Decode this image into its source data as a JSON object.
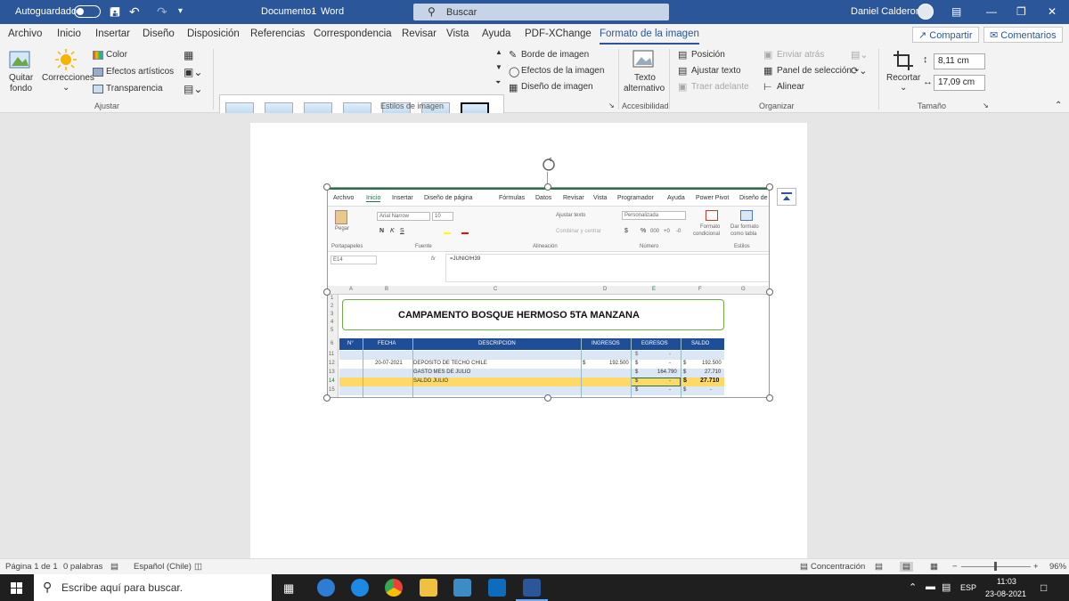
{
  "window": {
    "autosave_label": "Autoguardado",
    "doc_title": "Documento1",
    "app_name": "Word",
    "search_placeholder": "Buscar",
    "user_name": "Daniel Calderon"
  },
  "tabs": {
    "items": [
      "Archivo",
      "Inicio",
      "Insertar",
      "Diseño",
      "Disposición",
      "Referencias",
      "Correspondencia",
      "Revisar",
      "Vista",
      "Ayuda",
      "PDF-XChange",
      "Formato de la imagen"
    ],
    "active": "Formato de la imagen",
    "share": "Compartir",
    "comments": "Comentarios"
  },
  "ribbon": {
    "ajustar": {
      "quitar_fondo_1": "Quitar",
      "quitar_fondo_2": "fondo",
      "correcciones": "Correcciones",
      "color": "Color",
      "efectos_artisticos": "Efectos artísticos",
      "transparencia": "Transparencia",
      "label": "Ajustar"
    },
    "estilos": {
      "borde": "Borde de imagen",
      "efectos": "Efectos de la imagen",
      "diseno": "Diseño de imagen",
      "label": "Estilos de imagen"
    },
    "accesibilidad": {
      "texto_1": "Texto",
      "texto_2": "alternativo",
      "label": "Accesibilidad"
    },
    "organizar": {
      "posicion": "Posición",
      "ajustar_texto": "Ajustar texto",
      "traer_adelante": "Traer adelante",
      "enviar_atras": "Enviar atrás",
      "panel_seleccion": "Panel de selección",
      "alinear": "Alinear",
      "label": "Organizar"
    },
    "tamano": {
      "recortar": "Recortar",
      "height": "8,11 cm",
      "width": "17,09 cm",
      "label": "Tamaño"
    }
  },
  "excel_image": {
    "tabs": [
      "Archivo",
      "Inicio",
      "Insertar",
      "Diseño de página",
      "Fórmulas",
      "Datos",
      "Revisar",
      "Vista",
      "Programador",
      "Ayuda",
      "Power Pivot",
      "Diseño de"
    ],
    "clipboard": {
      "pegar": "Pegar",
      "label": "Portapapeles"
    },
    "font": {
      "name": "Arial Narrow",
      "size": "10",
      "bold": "N",
      "italic": "K",
      "underline": "S",
      "label": "Fuente"
    },
    "align": {
      "wrap": "Ajustar texto",
      "merge": "Combinar y centrar",
      "label": "Alineación"
    },
    "number": {
      "format": "Personalizada",
      "currency": "$",
      "percent": "%",
      "thousands": "000",
      "inc": "+0",
      "dec": "-0",
      "label": "Número"
    },
    "styles": {
      "cond_1": "Formato",
      "cond_2": "condicional",
      "table_1": "Dar formato",
      "table_2": "como tabla",
      "label": "Estilos"
    },
    "name_box": "E14",
    "formula": "=JUNIO!H39",
    "fx": "fx",
    "columns": [
      "A",
      "B",
      "C",
      "D",
      "E",
      "F",
      "G"
    ],
    "rows": [
      "1",
      "2",
      "3",
      "4",
      "5",
      "6",
      "11",
      "12",
      "13",
      "14",
      "15"
    ],
    "title": "CAMPAMENTO BOSQUE HERMOSO 5TA MANZANA",
    "headers": [
      "N°",
      "FECHA",
      "DESCRIPCION",
      "INGRESOS",
      "EGRESOS",
      "SALDO"
    ],
    "data_rows": [
      {
        "fecha": "",
        "desc": "",
        "ing_sym": "",
        "ing": "",
        "egr_sym": "$",
        "egr": "-",
        "sal_sym": "",
        "sal": ""
      },
      {
        "fecha": "20-07-2021",
        "desc": "DEPOSITO DE TECHO CHILE",
        "ing_sym": "$",
        "ing": "192.500",
        "egr_sym": "$",
        "egr": "-",
        "sal_sym": "$",
        "sal": "192.500"
      },
      {
        "fecha": "",
        "desc": "GASTO MES DE JULIO",
        "ing_sym": "",
        "ing": "",
        "egr_sym": "$",
        "egr": "164.790",
        "sal_sym": "$",
        "sal": "27.710"
      },
      {
        "fecha": "",
        "desc": "SALDO JULIO",
        "ing_sym": "",
        "ing": "",
        "egr_sym": "$",
        "egr": "-",
        "sal_sym": "$",
        "sal": "27.710"
      },
      {
        "fecha": "",
        "desc": "",
        "ing_sym": "",
        "ing": "",
        "egr_sym": "$",
        "egr": "-",
        "sal_sym": "$",
        "sal": "-"
      }
    ]
  },
  "statusbar": {
    "page": "Página 1 de 1",
    "words": "0 palabras",
    "language": "Español (Chile)",
    "focus": "Concentración",
    "zoom": "96%"
  },
  "taskbar": {
    "search": "Escribe aquí para buscar.",
    "lang": "ESP",
    "time": "11:03",
    "date": "23-08-2021"
  },
  "colors": {
    "word_blue": "#2b579a",
    "excel_header_blue": "#1f4e99",
    "highlight_yellow": "#ffd966",
    "title_border_green": "#70ad47"
  }
}
